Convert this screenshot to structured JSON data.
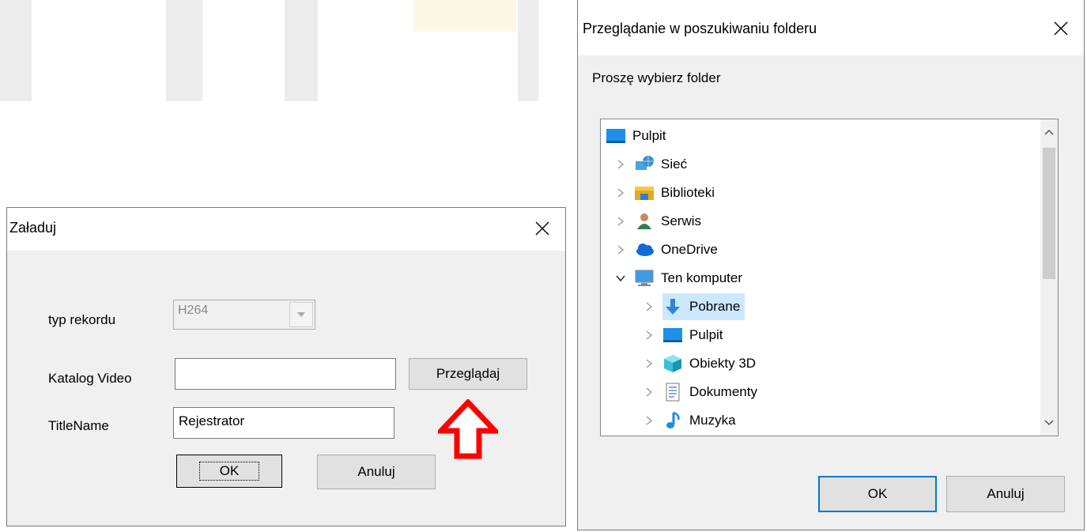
{
  "load_dialog": {
    "title": "Załaduj",
    "record_type_label": "typ rekordu",
    "record_type_value": "H264",
    "video_dir_label": "Katalog Video",
    "video_dir_value": "",
    "browse_label": "Przeglądaj",
    "title_name_label": "TitleName",
    "title_name_value": "Rejestrator",
    "ok_label": "OK",
    "cancel_label": "Anuluj"
  },
  "folder_dialog": {
    "title": "Przeglądanie w poszukiwaniu folderu",
    "prompt": "Proszę wybierz folder",
    "tree": [
      {
        "label": "Pulpit",
        "icon": "desktop-icon"
      },
      {
        "label": "Sieć",
        "icon": "network-icon"
      },
      {
        "label": "Biblioteki",
        "icon": "libraries-icon"
      },
      {
        "label": "Serwis",
        "icon": "user-icon"
      },
      {
        "label": "OneDrive",
        "icon": "onedrive-icon"
      },
      {
        "label": "Ten komputer",
        "icon": "computer-icon"
      },
      {
        "label": "Pobrane",
        "icon": "download-icon",
        "selected": true
      },
      {
        "label": "Pulpit",
        "icon": "desktop-icon"
      },
      {
        "label": "Obiekty 3D",
        "icon": "objects-3d-icon"
      },
      {
        "label": "Dokumenty",
        "icon": "documents-icon"
      },
      {
        "label": "Muzyka",
        "icon": "music-icon"
      }
    ],
    "ok_label": "OK",
    "cancel_label": "Anuluj"
  },
  "colors": {
    "highlight_arrow": "#ff0000",
    "selection": "#cce8ff",
    "default_button_border": "#0078d7"
  }
}
